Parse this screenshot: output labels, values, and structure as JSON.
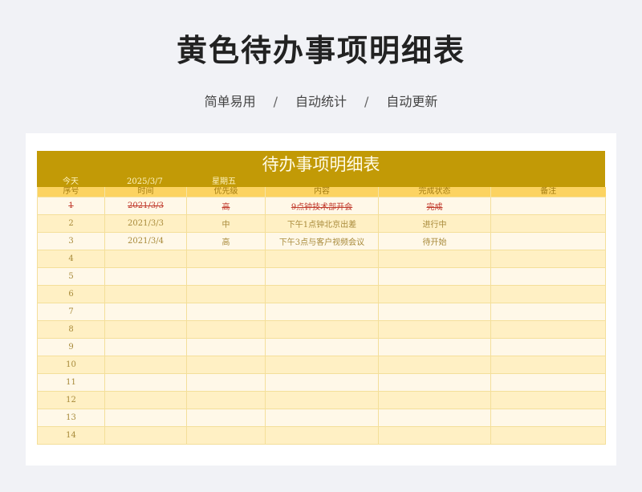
{
  "header": {
    "title": "黄色待办事项明细表",
    "tags": [
      "简单易用",
      "自动统计",
      "自动更新"
    ],
    "separator": "/"
  },
  "sheet": {
    "title": "待办事项明细表",
    "today_label": "今天",
    "today_date": "2025/3/7",
    "weekday": "星期五",
    "columns": [
      "序号",
      "时间",
      "优先级",
      "内容",
      "完成状态",
      "备注"
    ],
    "rows": [
      {
        "no": "1",
        "time": "2021/3/3",
        "priority": "高",
        "content": "9点钟技术部开会",
        "status": "完成",
        "note": ""
      },
      {
        "no": "2",
        "time": "2021/3/3",
        "priority": "中",
        "content": "下午1点钟北京出差",
        "status": "进行中",
        "note": ""
      },
      {
        "no": "3",
        "time": "2021/3/4",
        "priority": "高",
        "content": "下午3点与客户视频会议",
        "status": "待开始",
        "note": ""
      },
      {
        "no": "4",
        "time": "",
        "priority": "",
        "content": "",
        "status": "",
        "note": ""
      },
      {
        "no": "5",
        "time": "",
        "priority": "",
        "content": "",
        "status": "",
        "note": ""
      },
      {
        "no": "6",
        "time": "",
        "priority": "",
        "content": "",
        "status": "",
        "note": ""
      },
      {
        "no": "7",
        "time": "",
        "priority": "",
        "content": "",
        "status": "",
        "note": ""
      },
      {
        "no": "8",
        "time": "",
        "priority": "",
        "content": "",
        "status": "",
        "note": ""
      },
      {
        "no": "9",
        "time": "",
        "priority": "",
        "content": "",
        "status": "",
        "note": ""
      },
      {
        "no": "10",
        "time": "",
        "priority": "",
        "content": "",
        "status": "",
        "note": ""
      },
      {
        "no": "11",
        "time": "",
        "priority": "",
        "content": "",
        "status": "",
        "note": ""
      },
      {
        "no": "12",
        "time": "",
        "priority": "",
        "content": "",
        "status": "",
        "note": ""
      },
      {
        "no": "13",
        "time": "",
        "priority": "",
        "content": "",
        "status": "",
        "note": ""
      },
      {
        "no": "14",
        "time": "",
        "priority": "",
        "content": "",
        "status": "",
        "note": ""
      }
    ]
  },
  "colors": {
    "banner": "#c29a06",
    "header_row": "#fcd361",
    "row_light": "#fff8e8",
    "row_dark": "#fff0c4",
    "done_text": "#c0392b"
  }
}
